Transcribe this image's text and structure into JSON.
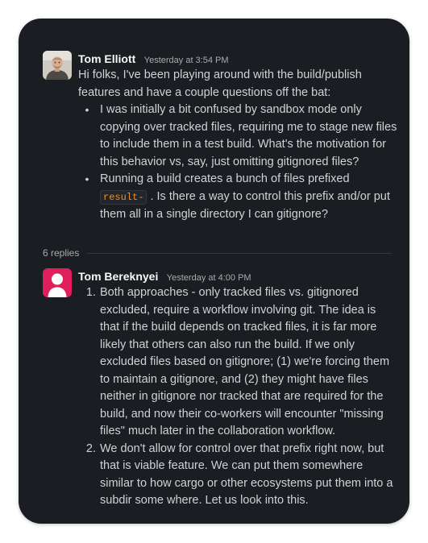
{
  "thread": {
    "messages": [
      {
        "author": "Tom Elliott",
        "timestamp": "Yesterday at 3:54 PM",
        "avatar_icon": "user-photo-icon",
        "intro": "Hi folks, I've been playing around with the build/publish features and have a couple questions off the bat:",
        "bullets": [
          "I was initially a bit confused by sandbox mode only copying over tracked files, requiring me to stage new files to include them in a test build. What's the motivation for this behavior vs, say, just omitting gitignored files?",
          {
            "before_code": "Running a build creates a bunch of files prefixed",
            "code": "result-",
            "after_code": ". Is there a way to control this prefix and/or put them all in a single directory I can gitignore?"
          }
        ]
      },
      {
        "author": "Tom Bereknyei",
        "timestamp": "Yesterday at 4:00 PM",
        "avatar_icon": "default-user-avatar-icon",
        "avatar_color": "#e01e5a",
        "items": [
          {
            "number": "1.",
            "text": "Both approaches - only tracked files vs. gitignored excluded, require a workflow involving git. The idea is that if the build depends on tracked files, it is far more likely that others can also run the build. If we only excluded files based on gitignore; (1) we're forcing them to maintain a gitignore, and (2) they might have files neither in gitignore nor tracked that are required for the build, and now their co-workers will encounter \"missing files\" much later in the collaboration workflow."
          },
          {
            "number": "2.",
            "text": "We don't allow for control over that prefix right now, but that is viable feature. We can put them somewhere similar to how cargo or other ecosystems put them into a subdir some where. Let us look into this."
          }
        ]
      }
    ],
    "replies_label": "6 replies"
  },
  "colors": {
    "background": "#1a1d21",
    "text": "#d1d2d3",
    "author": "#f8f8f8",
    "muted": "#ababad",
    "code": "#e8912d"
  }
}
